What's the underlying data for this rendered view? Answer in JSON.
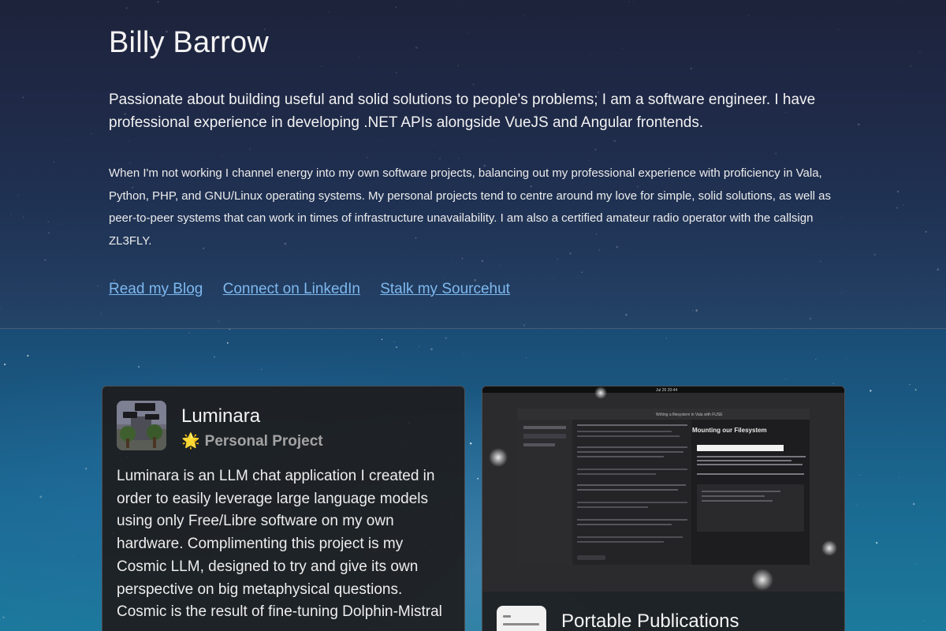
{
  "profile": {
    "name": "Billy Barrow",
    "tagline": "Passionate about building useful and solid solutions to people's problems; I am a software engineer. I have professional experience in developing .NET APIs alongside VueJS and Angular frontends.",
    "bio": "When I'm not working I channel energy into my own software projects, balancing out my professional experience with proficiency in Vala, Python, PHP, and GNU/Linux operating systems. My personal projects tend to centre around my love for simple, solid solutions, as well as peer-to-peer systems that can work in times of infrastructure unavailability. I am also a certified amateur radio operator with the callsign ZL3FLY."
  },
  "links": [
    {
      "label": "Read my Blog"
    },
    {
      "label": "Connect on LinkedIn"
    },
    {
      "label": "Stalk my Sourcehut"
    }
  ],
  "projects": [
    {
      "title": "Luminara",
      "tag": "Personal Project",
      "tag_icon": "star-icon",
      "description": "Luminara is an LLM chat application I created in order to easily leverage large language models using only Free/Libre software on my own hardware. Complimenting this project is my Cosmic LLM, designed to try and give its own perspective on big metaphysical questions. Cosmic is the result of fine-tuning Dolphin-Mistral"
    },
    {
      "title": "Portable Publications",
      "screenshot_window_title": "Writing a filesystem in Vala with FUSE",
      "screenshot_heading": "Mounting our Filesystem",
      "screenshot_clock": "Jul 26  20:44"
    }
  ],
  "colors": {
    "link": "#7fb8ef",
    "tag_star": "#f3c23b",
    "card_bg": "#1e1e20"
  }
}
